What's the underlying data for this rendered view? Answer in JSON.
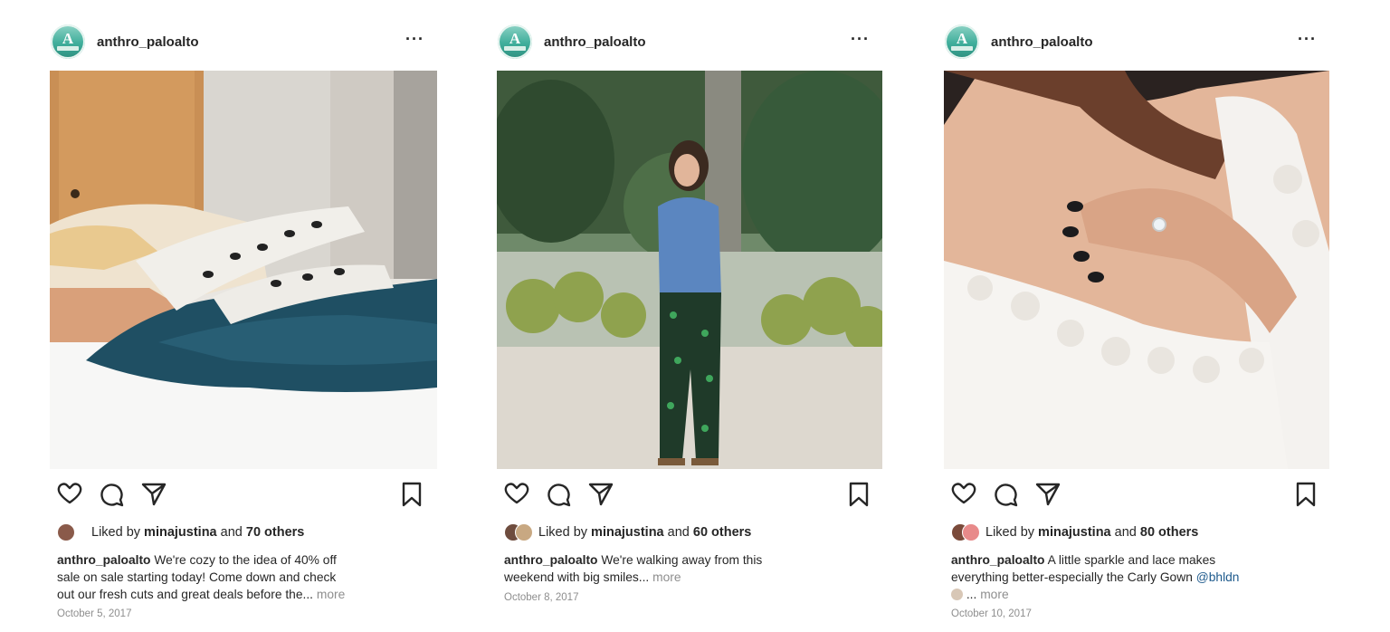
{
  "posts": [
    {
      "username": "anthro_paloalto",
      "avatar_letter": "A",
      "liked_by_prefix": "Liked by ",
      "liked_user": "minajustina",
      "liked_and": " and ",
      "liked_count": "70 others",
      "caption_user": "anthro_paloalto",
      "caption_lines": [
        "We're cozy to the idea of 40% off",
        "sale on sale starting today! Come down and check",
        "out our fresh cuts and great deals before the..."
      ],
      "more": "more",
      "date": "October 5, 2017"
    },
    {
      "username": "anthro_paloalto",
      "avatar_letter": "A",
      "liked_by_prefix": "Liked by ",
      "liked_user": "minajustina",
      "liked_and": " and ",
      "liked_count": "60 others",
      "caption_user": "anthro_paloalto",
      "caption_lines": [
        "We're walking away from this",
        "weekend with big smiles..."
      ],
      "more": "more",
      "date": "October 8, 2017"
    },
    {
      "username": "anthro_paloalto",
      "avatar_letter": "A",
      "liked_by_prefix": "Liked by ",
      "liked_user": "minajustina",
      "liked_and": " and ",
      "liked_count": "80 others",
      "caption_user": "anthro_paloalto",
      "caption_lines": [
        "A little sparkle and lace makes",
        "everything better-especially the Carly Gown",
        "..."
      ],
      "mention": "@bhldn",
      "more": "more",
      "date": "October 10, 2017"
    }
  ],
  "icons": [
    "more-options-icon",
    "heart-icon",
    "comment-icon",
    "share-icon",
    "bookmark-icon"
  ],
  "colors": {
    "text": "#262626",
    "muted": "#8e8e8e",
    "link": "#1f5b8d",
    "avatar": "#3fae9b"
  }
}
